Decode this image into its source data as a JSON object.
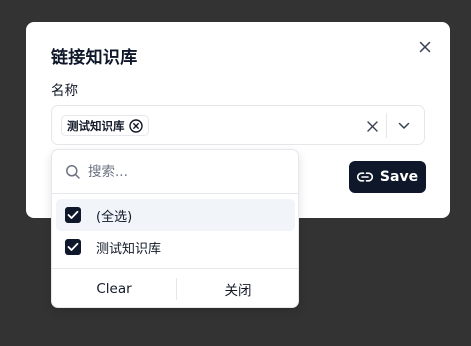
{
  "dialog": {
    "title": "链接知识库",
    "field_label": "名称",
    "selected_chip": "测试知识库",
    "save_label": "Save"
  },
  "dropdown": {
    "search_placeholder": "搜索...",
    "options": [
      {
        "label": "(全选)",
        "checked": true
      },
      {
        "label": "测试知识库",
        "checked": true
      }
    ],
    "clear_label": "Clear",
    "close_label": "关闭"
  },
  "icons": {
    "dialog_close": "close-icon",
    "chip_remove": "x-circle-icon",
    "clear_selection": "close-icon",
    "dropdown_toggle": "chevron-down-icon",
    "save": "link-icon",
    "search": "search-icon",
    "checkbox": "check-icon"
  },
  "colors": {
    "overlay": "#333333",
    "primary": "#0f172a",
    "highlight": "#f1f5f9",
    "border": "#e5e7eb"
  }
}
